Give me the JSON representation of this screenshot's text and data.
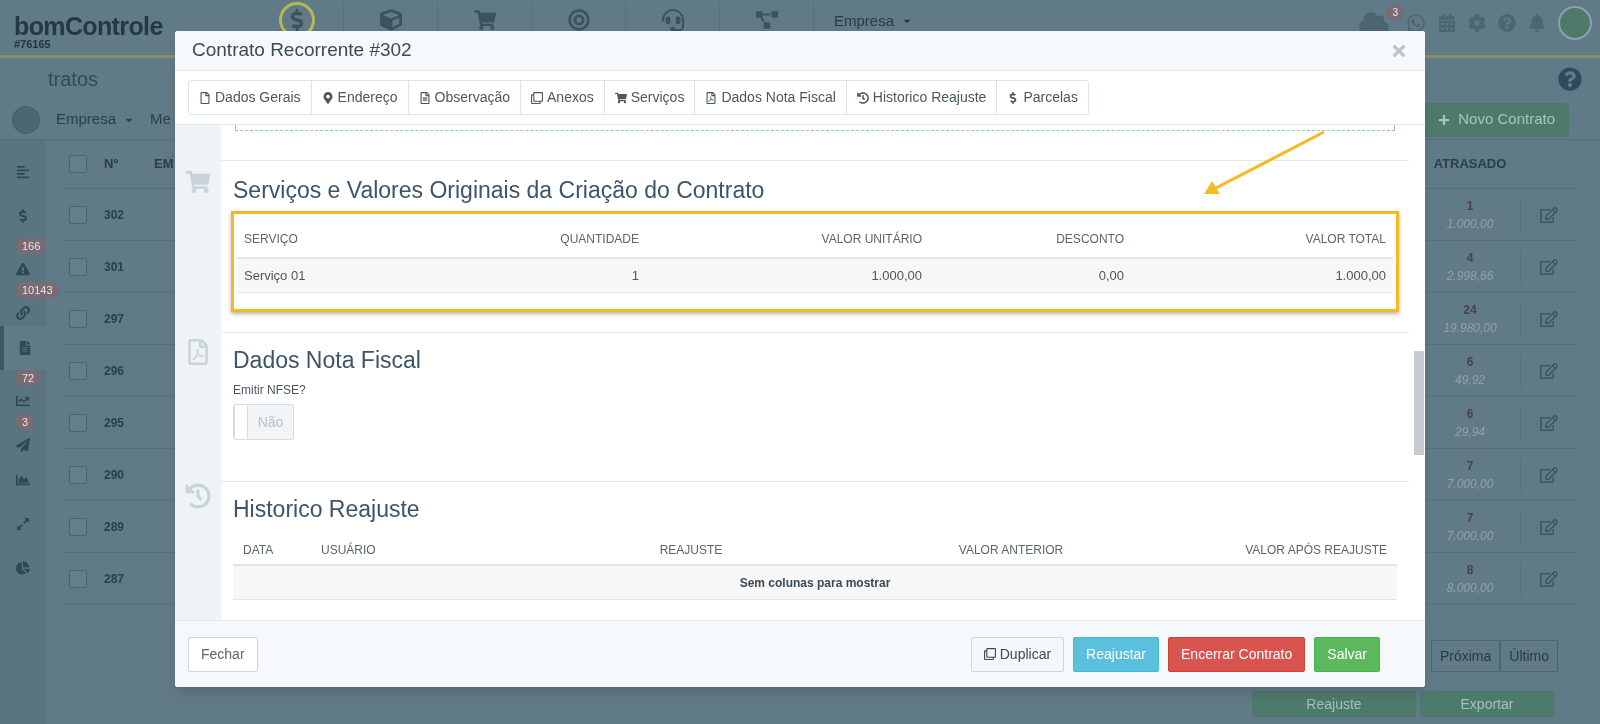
{
  "background": {
    "logo": "bomControle",
    "account": "#76165",
    "top_nav": [
      {
        "selected": true
      },
      {
        "selected": false
      },
      {
        "selected": false
      },
      {
        "selected": false
      },
      {
        "selected": false
      },
      {
        "selected": false
      }
    ],
    "company_menu": "Empresa",
    "notification_badge": "3",
    "page_title": "tratos",
    "filters": [
      "Empresa",
      "Me"
    ],
    "new_button": "Novo Contrato",
    "sidebar": [
      {
        "selected": false
      },
      {
        "selected": false
      },
      {
        "selected": false,
        "badge": "166"
      },
      {
        "selected": false,
        "badge": "10143"
      },
      {
        "selected": true
      },
      {
        "selected": false,
        "badge": "72"
      },
      {
        "selected": false,
        "badge": "3"
      },
      {
        "selected": false
      },
      {
        "selected": false
      },
      {
        "selected": false
      }
    ],
    "table": {
      "columns": [
        "Nº",
        "EM",
        "ATRASADO"
      ],
      "all_checked": false,
      "rows": [
        {
          "checked": false,
          "number": "302",
          "overdue_count": "1",
          "overdue_value": "1.000,00"
        },
        {
          "checked": false,
          "number": "301",
          "overdue_count": "4",
          "overdue_value": "2.998,66"
        },
        {
          "checked": false,
          "number": "297",
          "overdue_count": "24",
          "overdue_value": "19.980,00"
        },
        {
          "checked": false,
          "number": "296",
          "overdue_count": "6",
          "overdue_value": "49,92"
        },
        {
          "checked": false,
          "number": "295",
          "overdue_count": "6",
          "overdue_value": "29,94"
        },
        {
          "checked": false,
          "number": "290",
          "overdue_count": "7",
          "overdue_value": "7.000,00"
        },
        {
          "checked": false,
          "number": "289",
          "overdue_count": "7",
          "overdue_value": "7.000,00"
        },
        {
          "checked": false,
          "number": "287",
          "overdue_count": "8",
          "overdue_value": "8.000,00"
        }
      ]
    },
    "pager": [
      "Próxima",
      "Último"
    ],
    "actions": [
      "Reajuste",
      "Exportar"
    ]
  },
  "modal": {
    "title": "Contrato Recorrente #302",
    "tabs": [
      "Dados Gerais",
      "Endereço",
      "Observação",
      "Anexos",
      "Serviços",
      "Dados Nota Fiscal",
      "Historico Reajuste",
      "Parcelas"
    ],
    "services_section": {
      "heading": "Serviços e Valores Originais da Criação do Contrato",
      "columns": [
        "SERVIÇO",
        "QUANTIDADE",
        "VALOR UNITÁRIO",
        "DESCONTO",
        "VALOR TOTAL"
      ],
      "rows": [
        [
          "Serviço 01",
          "1",
          "1.000,00",
          "0,00",
          "1.000,00"
        ]
      ]
    },
    "invoice_section": {
      "heading": "Dados Nota Fiscal",
      "field_label": "Emitir NFSE?",
      "toggle": {
        "label": "Não",
        "on": false
      }
    },
    "history_section": {
      "heading": "Historico Reajuste",
      "columns": [
        "DATA",
        "USUÁRIO",
        "REAJUSTE",
        "VALOR ANTERIOR",
        "VALOR APÓS REAJUSTE"
      ],
      "empty_message": "Sem colunas para mostrar"
    },
    "footer": {
      "close": "Fechar",
      "buttons": [
        {
          "label": "Duplicar",
          "kind": "default"
        },
        {
          "label": "Reajustar",
          "kind": "info"
        },
        {
          "label": "Encerrar Contrato",
          "kind": "danger"
        },
        {
          "label": "Salvar",
          "kind": "success"
        }
      ]
    }
  }
}
